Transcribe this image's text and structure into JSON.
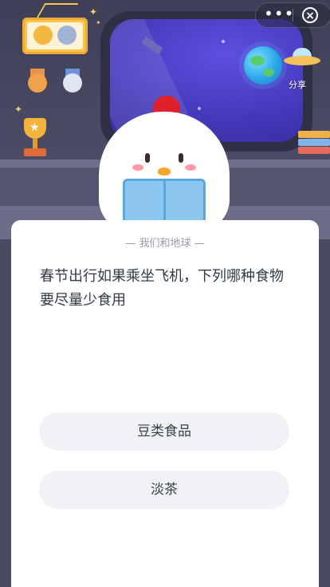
{
  "header": {
    "share_label": "分享",
    "more_icon": "more-dots-icon",
    "close_icon": "close-circle-icon"
  },
  "quiz": {
    "section_title": "— 我们和地球 —",
    "question": "春节出行如果乘坐飞机，下列哪种食物要尽量少食用",
    "options": [
      "豆类食品",
      "淡茶"
    ]
  },
  "colors": {
    "background": "#4b4b65",
    "card": "#ffffff",
    "option_bg": "#f1f2f5",
    "text": "#333a45",
    "muted": "#9a9aa6"
  }
}
